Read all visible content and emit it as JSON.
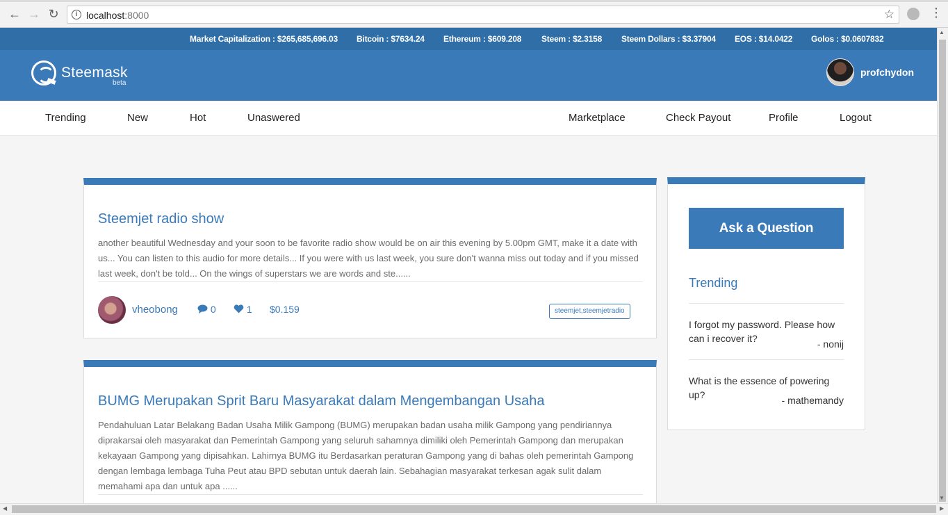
{
  "browser": {
    "url_host": "localhost",
    "url_port": ":8000",
    "info_glyph": "i",
    "back": "←",
    "forward": "→",
    "reload": "↻",
    "star": "☆",
    "menu": "⋮"
  },
  "ticker": [
    {
      "label": "Market Capitalization : $265,685,696.03"
    },
    {
      "label": "Bitcoin : $7634.24"
    },
    {
      "label": "Ethereum : $609.208"
    },
    {
      "label": "Steem : $2.3158"
    },
    {
      "label": "Steem Dollars : $3.37904"
    },
    {
      "label": "EOS : $14.0422"
    },
    {
      "label": "Golos : $0.0607832"
    }
  ],
  "header": {
    "logo_text": "Steemask",
    "logo_beta": "beta",
    "username": "profchydon"
  },
  "nav": {
    "left": [
      "Trending",
      "New",
      "Hot",
      "Unaswered"
    ],
    "right": [
      "Marketplace",
      "Check Payout",
      "Profile",
      "Logout"
    ]
  },
  "posts": [
    {
      "title": "Steemjet radio show",
      "body": "another beautiful Wednesday and your soon to be favorite radio show would be on air this evening by 5.00pm GMT, make it a date with us... You can listen to this audio for more details... If you were with us last week, you sure don't wanna miss out today and if you missed last week, don't be told... On the wings of superstars we are words and ste......",
      "author": "vheobong",
      "comments": "0",
      "likes": "1",
      "payout": "$0.159",
      "tags": "steemjet,steemjetradio"
    },
    {
      "title": "BUMG Merupakan Sprit Baru Masyarakat dalam Mengembangan Usaha",
      "body": "Pendahuluan Latar Belakang Badan Usaha Milik Gampong (BUMG) merupakan badan usaha milik Gampong yang pendiriannya diprakarsai oleh masyarakat dan Pemerintah Gampong yang seluruh sahamnya dimiliki oleh Pemerintah Gampong dan merupakan kekayaan Gampong yang dipisahkan. Lahirnya BUMG itu Berdasarkan peraturan Gampong yang di bahas oleh pemerintah Gampong dengan lembaga lembaga Tuha Peut atau BPD sebutan untuk daerah lain. Sebahagian masyarakat terkesan agak sulit dalam memahami apa dan untuk apa ......"
    }
  ],
  "sidebar": {
    "ask_label": "Ask a Question",
    "trending_heading": "Trending",
    "questions": [
      {
        "text": "I forgot my password. Please how can i recover it?",
        "author": "- nonij"
      },
      {
        "text": "What is the essence of powering up?",
        "author": "- mathemandy"
      }
    ]
  },
  "colors": {
    "ticker_bg": "#2f6ea7",
    "header_bg": "#3a7ab9",
    "accent": "#3a7ab9"
  }
}
